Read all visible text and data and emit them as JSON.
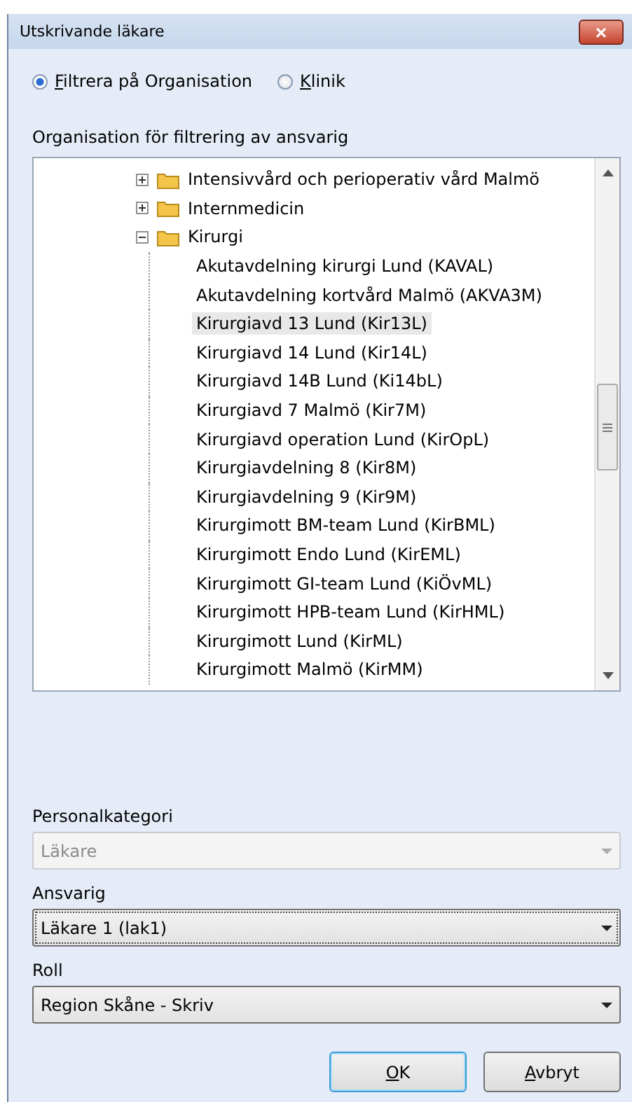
{
  "window": {
    "title": "Utskrivande läkare",
    "close": "×"
  },
  "filter_options": [
    {
      "label": "Filtrera på Organisation",
      "selected": true
    },
    {
      "label": "Klinik",
      "selected": false
    }
  ],
  "tree": {
    "label": "Organisation för filtrering av ansvarig",
    "items": [
      {
        "label": "Intensivvård och perioperativ vård Malmö",
        "expanded": false,
        "selected": false
      },
      {
        "label": "Internmedicin",
        "expanded": false,
        "selected": false
      },
      {
        "label": "Kirurgi",
        "expanded": true,
        "selected": false,
        "children": [
          {
            "label": "Akutavdelning kirurgi Lund (KAVAL)",
            "selected": false
          },
          {
            "label": "Akutavdelning kortvård Malmö (AKVA3M)",
            "selected": false
          },
          {
            "label": "Kirurgiavd 13 Lund (Kir13L)",
            "selected": true
          },
          {
            "label": "Kirurgiavd 14 Lund (Kir14L)",
            "selected": false
          },
          {
            "label": "Kirurgiavd 14B Lund (Ki14bL)",
            "selected": false
          },
          {
            "label": "Kirurgiavd 7 Malmö (Kir7M)",
            "selected": false
          },
          {
            "label": "Kirurgiavd operation Lund (KirOpL)",
            "selected": false
          },
          {
            "label": "Kirurgiavdelning 8 (Kir8M)",
            "selected": false
          },
          {
            "label": "Kirurgiavdelning 9 (Kir9M)",
            "selected": false
          },
          {
            "label": "Kirurgimott BM-team Lund (KirBML)",
            "selected": false
          },
          {
            "label": "Kirurgimott Endo Lund (KirEML)",
            "selected": false
          },
          {
            "label": "Kirurgimott GI-team Lund (KiÖvML)",
            "selected": false
          },
          {
            "label": "Kirurgimott HPB-team Lund (KirHML)",
            "selected": false
          },
          {
            "label": "Kirurgimott Lund (KirML)",
            "selected": false
          },
          {
            "label": "Kirurgimott Malmö (KirMM)",
            "selected": false
          }
        ]
      }
    ]
  },
  "fields": [
    {
      "label": "Personalkategori",
      "value": "Läkare",
      "disabled": true
    },
    {
      "label": "Ansvarig",
      "value": "Läkare 1 (lak1)",
      "disabled": false
    },
    {
      "label": "Roll",
      "value": "Region Skåne - Skriv",
      "disabled": false
    }
  ],
  "buttons": [
    {
      "label": "OK",
      "default": true
    },
    {
      "label": "Avbryt",
      "default": false
    }
  ]
}
